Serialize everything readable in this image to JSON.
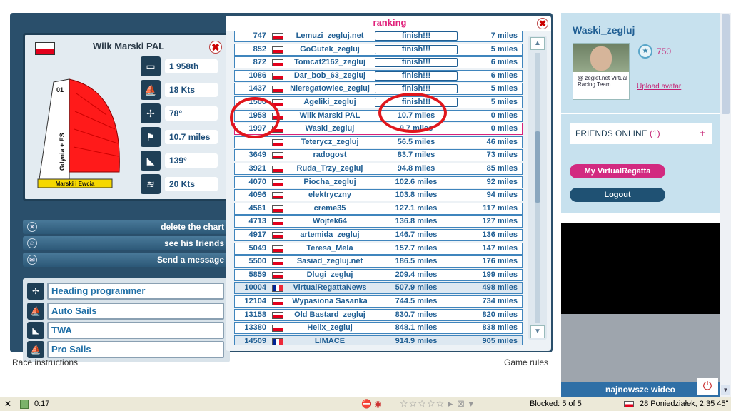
{
  "boat_card": {
    "name": "Wilk Marski PAL",
    "close": "✖",
    "sail_number": "01",
    "hull_text": "Gdynia + ES",
    "hull_label": "Marski i Ewcia",
    "stats": [
      {
        "icon": "ranking-icon",
        "value": "1 958th"
      },
      {
        "icon": "speed-icon",
        "value": "18 Kts"
      },
      {
        "icon": "heading-icon",
        "value": "78°"
      },
      {
        "icon": "distance-icon",
        "value": "10.7 miles"
      },
      {
        "icon": "twa-icon",
        "value": "139°"
      },
      {
        "icon": "wind-icon",
        "value": "20 Kts"
      }
    ]
  },
  "actions": {
    "delete": "delete the chart",
    "friends": "see his friends",
    "message": "Send a message"
  },
  "programmer": [
    {
      "icon": "heading-programmer-icon",
      "label": "Heading programmer"
    },
    {
      "icon": "auto-sails-icon",
      "label": "Auto Sails"
    },
    {
      "icon": "twa-programmer-icon",
      "label": "TWA"
    },
    {
      "icon": "pro-sails-icon",
      "label": "Pro Sails"
    }
  ],
  "ranking": {
    "title": "ranking",
    "close": "✖",
    "rows": [
      {
        "pos": "747",
        "flag": "pl",
        "name": "Lemuzi_zegluj.net",
        "dist": "finish!!!",
        "finish": true,
        "gap": "7 miles"
      },
      {
        "pos": "852",
        "flag": "pl",
        "name": "GoGutek_zegluj",
        "dist": "finish!!!",
        "finish": true,
        "gap": "5 miles"
      },
      {
        "pos": "872",
        "flag": "pl",
        "name": "Tomcat2162_zegluj",
        "dist": "finish!!!",
        "finish": true,
        "gap": "6 miles"
      },
      {
        "pos": "1086",
        "flag": "pl",
        "name": "Dar_bob_63_zegluj",
        "dist": "finish!!!",
        "finish": true,
        "gap": "6 miles"
      },
      {
        "pos": "1437",
        "flag": "pl",
        "name": "Nieregatowiec_zegluj",
        "dist": "finish!!!",
        "finish": true,
        "gap": "5 miles"
      },
      {
        "pos": "1500",
        "flag": "pl",
        "name": "Ageliki_zegluj",
        "dist": "finish!!!",
        "finish": true,
        "gap": "5 miles"
      },
      {
        "pos": "1958",
        "flag": "pl",
        "name": "Wilk Marski PAL",
        "dist": "10.7 miles",
        "finish": false,
        "gap": "0 miles"
      },
      {
        "pos": "1997",
        "flag": "pl",
        "name": "Waski_zegluj",
        "dist": "9.7 miles",
        "finish": false,
        "gap": "0 miles",
        "mine": true
      },
      {
        "pos": "",
        "flag": "pl",
        "name": "Teterycz_zegluj",
        "dist": "56.5 miles",
        "finish": false,
        "gap": "46 miles"
      },
      {
        "pos": "3649",
        "flag": "pl",
        "name": "radogost",
        "dist": "83.7 miles",
        "finish": false,
        "gap": "73 miles"
      },
      {
        "pos": "3921",
        "flag": "pl",
        "name": "Ruda_Trzy_zegluj",
        "dist": "94.8 miles",
        "finish": false,
        "gap": "85 miles"
      },
      {
        "pos": "4070",
        "flag": "pl",
        "name": "Piocha_zegluj",
        "dist": "102.6 miles",
        "finish": false,
        "gap": "92 miles"
      },
      {
        "pos": "4096",
        "flag": "pl",
        "name": "elektryczny",
        "dist": "103.8 miles",
        "finish": false,
        "gap": "94 miles"
      },
      {
        "pos": "4561",
        "flag": "pl",
        "name": "creme35",
        "dist": "127.1 miles",
        "finish": false,
        "gap": "117 miles"
      },
      {
        "pos": "4713",
        "flag": "pl",
        "name": "Wojtek64",
        "dist": "136.8 miles",
        "finish": false,
        "gap": "127 miles"
      },
      {
        "pos": "4917",
        "flag": "pl",
        "name": "artemida_zegluj",
        "dist": "146.7 miles",
        "finish": false,
        "gap": "136 miles"
      },
      {
        "pos": "5049",
        "flag": "pl",
        "name": "Teresa_Mela",
        "dist": "157.7 miles",
        "finish": false,
        "gap": "147 miles"
      },
      {
        "pos": "5500",
        "flag": "pl",
        "name": "Sasiad_zegluj.net",
        "dist": "186.5 miles",
        "finish": false,
        "gap": "176 miles"
      },
      {
        "pos": "5859",
        "flag": "pl",
        "name": "Dlugi_zegluj",
        "dist": "209.4 miles",
        "finish": false,
        "gap": "199 miles"
      },
      {
        "pos": "10004",
        "flag": "fr",
        "name": "VirtualRegattaNews",
        "dist": "507.9 miles",
        "finish": false,
        "gap": "498 miles"
      },
      {
        "pos": "12104",
        "flag": "pl",
        "name": "Wypasiona Sasanka",
        "dist": "744.5 miles",
        "finish": false,
        "gap": "734 miles"
      },
      {
        "pos": "13158",
        "flag": "pl",
        "name": "Old Bastard_zegluj",
        "dist": "830.7 miles",
        "finish": false,
        "gap": "820 miles"
      },
      {
        "pos": "13380",
        "flag": "pl",
        "name": "Helix_zegluj",
        "dist": "848.1 miles",
        "finish": false,
        "gap": "838 miles"
      },
      {
        "pos": "14509",
        "flag": "fr",
        "name": "LIMACE",
        "dist": "914.9 miles",
        "finish": false,
        "gap": "905 miles"
      }
    ]
  },
  "footer": {
    "race_instructions": "Race instructions",
    "game_rules": "Game rules"
  },
  "profile": {
    "username": "Waski_zegluj",
    "points": "750",
    "upload_avatar": "Upload avatar",
    "avatar_caption": "@ zeglet.net Virtual Racing Team"
  },
  "friends": {
    "label": "FRIENDS ONLINE ",
    "count": "(1)",
    "plus": "+"
  },
  "buttons": {
    "my_vr": "My VirtualRegatta",
    "logout": "Logout"
  },
  "promo": "najnowsze wideo",
  "statusbar": {
    "close": "✕",
    "time": "0:17",
    "blocked": "Blocked: 5 of 5",
    "datetime": "28 Poniedziałek, 2:35 45\""
  },
  "colors": {
    "accent_pink": "#d22a80",
    "game_navy": "#2a4f6b",
    "sidebar_blue": "#c7e1ee",
    "annotation_red": "#e0161c"
  }
}
